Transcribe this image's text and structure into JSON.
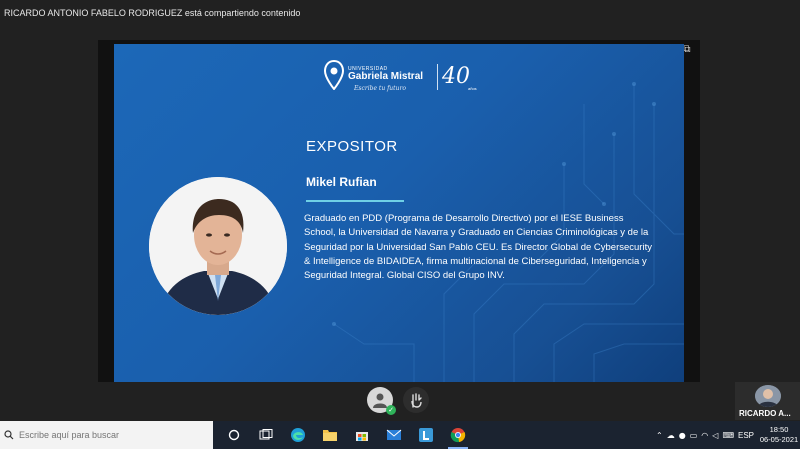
{
  "share_banner": "RICARDO ANTONIO FABELO RODRIGUEZ está compartiendo contenido",
  "slide": {
    "logo": {
      "university_label": "UNIVERSIDAD",
      "university_name": "Gabriela Mistral",
      "tagline": "Escribe tu futuro",
      "anniversary": "40",
      "anniversary_sub": "años"
    },
    "heading": "EXPOSITOR",
    "speaker_name": "Mikel Rufian",
    "bio": "Graduado en PDD (Programa de Desarrollo Directivo) por el IESE Business School, la Universidad de Navarra y Graduado en Ciencias Criminológicas y de la Seguridad por la Universidad San Pablo CEU. Es Director Global de Cybersecurity & Intelligence de BIDAIDEA, firma multinacional de Ciberseguridad, Inteligencia y Seguridad Integral. Global CISO del Grupo INV."
  },
  "participant": {
    "name": "RICARDO A..."
  },
  "taskbar": {
    "search_placeholder": "Escribe aquí para buscar",
    "language": "ESP",
    "time": "18:50",
    "date": "06-05-2021"
  },
  "icons": {
    "window_controls": [
      "minimize-icon",
      "restore-icon",
      "screen-share-icon"
    ],
    "call_bar": [
      "self-avatar-icon",
      "raise-hand-icon"
    ],
    "taskbar_apps": [
      "cortana-icon",
      "task-view-icon",
      "edge-icon",
      "file-explorer-icon",
      "store-icon",
      "mail-icon",
      "l-app-icon",
      "chrome-icon"
    ],
    "tray": [
      "chevron-up-icon",
      "onedrive-icon",
      "microphone-icon",
      "battery-icon",
      "wifi-icon",
      "volume-icon",
      "keyboard-icon"
    ]
  },
  "colors": {
    "slide_blue": "#1c68b8",
    "accent_cyan": "#6fd0e6",
    "taskbar": "#1b2330"
  }
}
